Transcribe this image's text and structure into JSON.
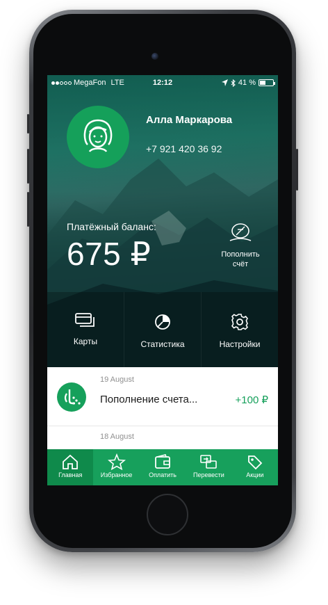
{
  "status_bar": {
    "carrier": "MegaFon",
    "network": "LTE",
    "time": "12:12",
    "battery": "41 %",
    "signal_dots_filled": 2,
    "signal_dots_total": 5
  },
  "profile": {
    "name": "Алла Маркарова",
    "phone": "+7 921 420 36 92"
  },
  "balance": {
    "label": "Платёжный баланс:",
    "value": "675 ₽"
  },
  "topup": {
    "label": "Пополнить счёт",
    "icon": "coin-plus-icon"
  },
  "quick_actions": [
    {
      "label": "Карты",
      "icon": "cards-icon"
    },
    {
      "label": "Статистика",
      "icon": "pie-chart-icon"
    },
    {
      "label": "Настройки",
      "icon": "gear-icon"
    }
  ],
  "feed": {
    "groups": [
      {
        "date": "19 August",
        "items": [
          {
            "title": "Пополнение счета...",
            "amount": "+100 ₽",
            "icon": "megafon-logo-icon"
          }
        ]
      },
      {
        "date": "18 August",
        "items": []
      }
    ]
  },
  "tabs": [
    {
      "label": "Главная",
      "icon": "home-icon",
      "active": true
    },
    {
      "label": "Избранное",
      "icon": "star-icon",
      "active": false
    },
    {
      "label": "Оплатить",
      "icon": "wallet-icon",
      "active": false
    },
    {
      "label": "Перевести",
      "icon": "transfer-icon",
      "active": false
    },
    {
      "label": "Акции",
      "icon": "tag-icon",
      "active": false
    }
  ],
  "colors": {
    "brand_green": "#17a05c",
    "active_tab": "#0f8a4b",
    "amount_green": "#16a05b",
    "muted_text": "#8f8f8f"
  }
}
